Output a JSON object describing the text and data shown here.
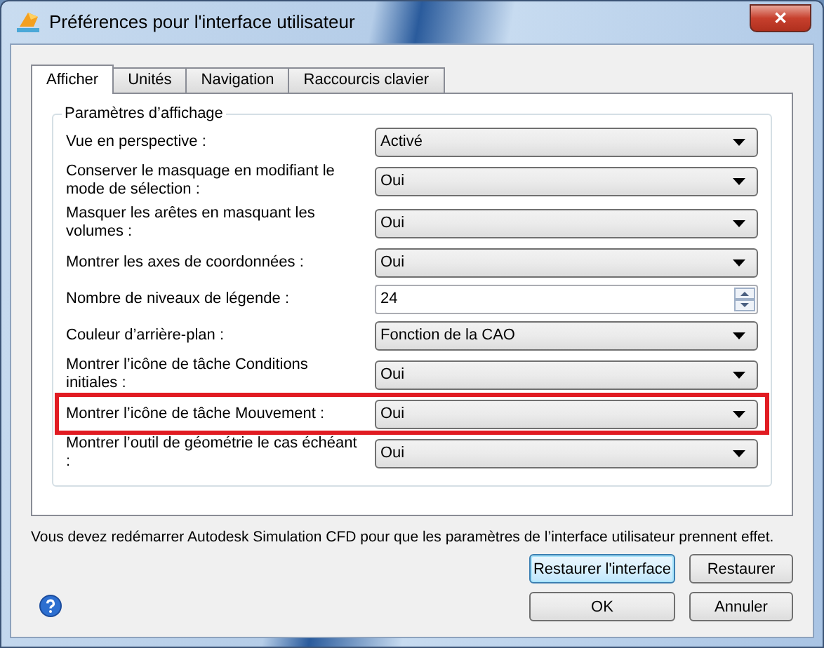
{
  "window": {
    "title": "Préférences pour l'interface utilisateur",
    "close": "✕"
  },
  "tabs": [
    {
      "label": "Afficher",
      "selected": true
    },
    {
      "label": "Unités",
      "selected": false
    },
    {
      "label": "Navigation",
      "selected": false
    },
    {
      "label": "Raccourcis clavier",
      "selected": false
    }
  ],
  "group": {
    "title": "Paramètres d’affichage"
  },
  "settings": [
    {
      "label": "Vue en perspective :",
      "kind": "select",
      "value": "Activé",
      "highlighted": false
    },
    {
      "label": "Conserver le masquage en modifiant le mode de sélection :",
      "kind": "select",
      "value": "Oui",
      "highlighted": false
    },
    {
      "label": "Masquer les arêtes en masquant les volumes :",
      "kind": "select",
      "value": "Oui",
      "highlighted": false
    },
    {
      "label": "Montrer les axes de coordonnées :",
      "kind": "select",
      "value": "Oui",
      "highlighted": false
    },
    {
      "label": "Nombre de niveaux de légende :",
      "kind": "spin",
      "value": "24",
      "highlighted": false
    },
    {
      "label": "Couleur d’arrière-plan :",
      "kind": "select",
      "value": "Fonction de la CAO",
      "highlighted": false
    },
    {
      "label": "Montrer l’icône de tâche Conditions initiales :",
      "kind": "select",
      "value": "Oui",
      "highlighted": false
    },
    {
      "label": "Montrer l’icône de tâche Mouvement :",
      "kind": "select",
      "value": "Oui",
      "highlighted": true
    },
    {
      "label": "Montrer l’outil de géométrie le cas échéant :",
      "kind": "select",
      "value": "Oui",
      "highlighted": false
    }
  ],
  "message": "Vous devez redémarrer Autodesk Simulation CFD pour que les paramètres de l’interface utilisateur prennent effet.",
  "buttons": [
    {
      "label": "Restaurer l'interface",
      "selected": true
    },
    {
      "label": "Restaurer",
      "selected": false
    },
    {
      "label": "OK",
      "selected": false
    },
    {
      "label": "Annuler",
      "selected": false
    }
  ]
}
